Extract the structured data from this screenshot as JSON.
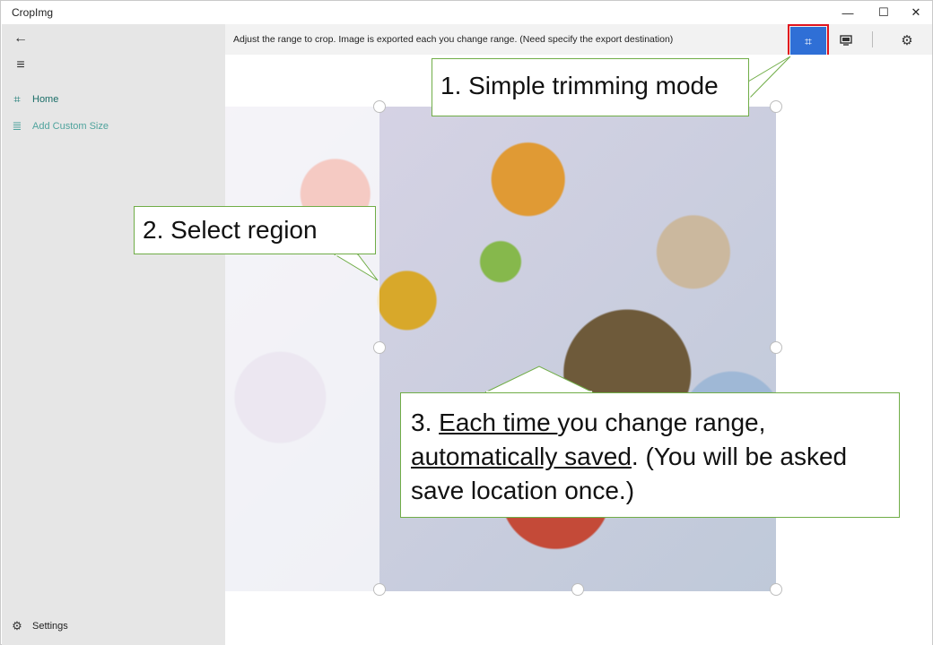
{
  "window": {
    "title": "CropImg",
    "controls": {
      "minimize": "—",
      "maximize": "☐",
      "close": "✕"
    }
  },
  "sidebar": {
    "back_icon": "←",
    "menu_icon": "≡",
    "items": [
      {
        "label": "Home",
        "icon": "crop-icon",
        "glyph": "⌗"
      },
      {
        "label": "Add Custom Size",
        "icon": "list-icon",
        "glyph": "≣"
      }
    ],
    "settings": {
      "label": "Settings",
      "icon": "gear-icon",
      "glyph": "⚙"
    }
  },
  "toolbar": {
    "info": "Adjust the range to crop. Image is exported each you change range. (Need specify the export destination)",
    "crop_icon": "⌗",
    "monitor_icon": "▭",
    "gear_icon": "⚙"
  },
  "callouts": {
    "c1": "1. Simple trimming mode",
    "c2": "2. Select region",
    "c3": {
      "prefix": "3. ",
      "underline1": "Each time ",
      "mid": "you change range, ",
      "underline2": "automatically saved",
      "suffix": ". (You will be asked save location once.)"
    }
  },
  "colors": {
    "accent": "#2f6fd6",
    "highlight_border": "#e0141e",
    "callout_border": "#70ad47",
    "sidebar_bg": "#e6e6e6",
    "nav_text": "#1b6e68"
  }
}
